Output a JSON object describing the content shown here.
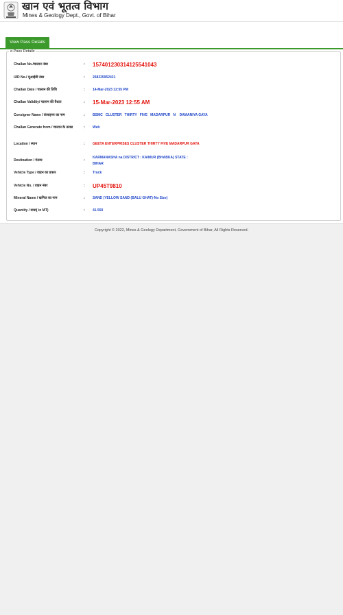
{
  "header": {
    "title_hindi": "खान एवं भूतत्व विभाग",
    "title_english": "Mines & Geology Dept., Govt. of Bihar"
  },
  "tabs": {
    "view_pass_label": "View Pass Details"
  },
  "epass": {
    "legend": "e-Pass Details",
    "rows": [
      {
        "label": "Challan No./चालान नंबर",
        "value": "157401230314125541043"
      },
      {
        "label": "UID No./ यूआईडी नंबर",
        "value": "268225952431"
      },
      {
        "label": "Challan Date / चालान की तिथि",
        "value": "14-Mar-2023 12:55 PM"
      },
      {
        "label": "Challan Validity/ चालान की वैधता",
        "value": "15-Mar-2023 12:55 AM"
      },
      {
        "label": "Consigner Name / कंसाइनर का नाम",
        "value": "BSMC   CLUSTER   THIRTY   FIVE   MADARPUR   N    DAMANIYA GAYA"
      },
      {
        "label": "Challan Generate from / चालान के उत्पन्न",
        "value": "Web"
      },
      {
        "label": "Location / स्थान",
        "value": "GEETA ENTERPRISES CLUSTER THIRTY FIVE MADARPUR GAYA"
      },
      {
        "label": "Destination / गंतव्य",
        "value_line1": "KARMANASHA na DISTRICT : KAIMUR (BHABUA) STATE :",
        "value_line2": "BIHAR"
      },
      {
        "label": "Vehicle Type / वाहन का प्रकार",
        "value": "Truck"
      },
      {
        "label": "Vehicle No. / वाहन नंबर",
        "value": "UP45T9810"
      },
      {
        "label": "Mineral Name / खनिज का नाम",
        "value": "SAND (YELLOW SAND (BALU GHAT)-No Size)"
      },
      {
        "label": "Quantity / मात्रा( in MT)",
        "value": "41.550"
      }
    ],
    "separator": ":"
  },
  "footer": {
    "copyright": "Copyright © 2022, Mines & Geology Department, Government of Bihar, All Rights Reserved."
  },
  "colors": {
    "brand_green": "#3c9a2c",
    "value_blue": "#1e45c8",
    "value_red": "#e3150f"
  }
}
